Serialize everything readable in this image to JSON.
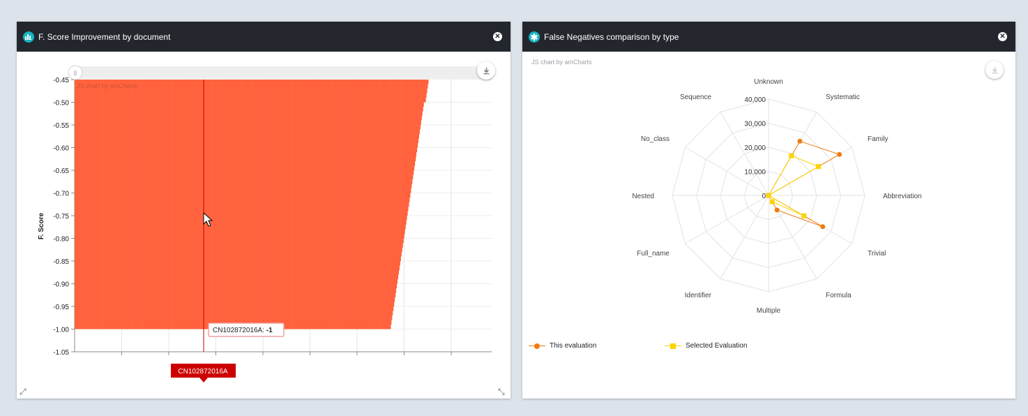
{
  "colors": {
    "header_bg": "#23272d",
    "icon_accent": "#17b4c2",
    "bar_fill": "#ff623d",
    "this_eval": "#f07b12",
    "selected_eval": "#fcd202",
    "cursor_line": "#cc0000",
    "tooltip_bg": "#cc0000"
  },
  "left_panel": {
    "title": "F. Score Improvement by document",
    "icon": "bar-chart-icon",
    "close_icon": "close-icon",
    "credit": "JS chart by amCharts",
    "tooltip_value_label": "CN102872016A:",
    "tooltip_value": "-1",
    "cursor_category": "CN102872016A",
    "scrollbar_grip": "||"
  },
  "right_panel": {
    "title": "False Negatives comparison by type",
    "icon": "asterisk-icon",
    "close_icon": "close-icon",
    "credit": "JS chart by amCharts"
  },
  "chart_data": [
    {
      "type": "bar",
      "title": "",
      "ylabel": "F. Score",
      "xlabel": "",
      "ylim": [
        -1.05,
        -0.45
      ],
      "yticks": [
        "-0.45",
        "-0.50",
        "-0.55",
        "-0.60",
        "-0.65",
        "-0.70",
        "-0.75",
        "-0.80",
        "-0.85",
        "-0.90",
        "-0.95",
        "-1.00",
        "-1.05"
      ],
      "grid": true,
      "series": [
        {
          "values": [
            -0.45,
            -0.45,
            -0.45,
            -0.45,
            -0.45,
            -0.45,
            -0.45,
            -0.45,
            -0.45,
            -0.45,
            -0.45,
            -0.45,
            -0.45,
            -0.45,
            -0.45,
            -0.45,
            -0.45,
            -0.45,
            -0.45,
            -0.45,
            -0.45,
            -0.45,
            -0.45,
            -0.45,
            -0.45,
            -0.45,
            -0.45,
            -0.45,
            -0.45,
            -0.45,
            -0.45,
            -0.45,
            -0.45,
            -0.45,
            -0.45,
            -0.45,
            -0.45,
            -0.45,
            -0.45,
            -0.45,
            -0.45,
            -0.45,
            -0.45,
            -0.45,
            -0.45,
            -0.45,
            -0.45,
            -0.45,
            -0.45,
            -0.45,
            -0.45,
            -0.45,
            -0.45,
            -0.45,
            -0.45,
            -0.45,
            -0.45,
            -0.45,
            -0.45,
            -0.45,
            -0.45,
            -0.45,
            -0.45,
            -0.45,
            -0.45,
            -0.45,
            -0.45,
            -0.45,
            -0.45,
            -0.45,
            -0.45,
            -0.45,
            -0.45,
            -0.45,
            -0.45,
            -0.45,
            -0.45,
            -0.45,
            -0.45,
            -0.45,
            -0.45,
            -0.45,
            -0.45,
            -0.45,
            -0.45,
            -0.45,
            -0.45,
            -0.45,
            -0.45,
            -0.45,
            -0.45,
            -0.45,
            -0.45,
            -0.45,
            -0.46,
            -0.47,
            -0.48,
            -0.49,
            -0.5,
            -0.5,
            -0.5,
            -0.51,
            -0.52,
            -0.53,
            -0.54,
            -0.55,
            -0.56,
            -0.57,
            -0.58,
            -0.59,
            -0.6,
            -0.61,
            -0.62,
            -0.63,
            -0.64,
            -0.65,
            -0.66,
            -0.67,
            -0.68,
            -0.69,
            -0.7,
            -0.71,
            -0.72,
            -0.73,
            -0.74,
            -0.75,
            -0.76,
            -0.77,
            -0.78,
            -0.79,
            -0.8,
            -0.81,
            -0.82,
            -0.83,
            -0.84,
            -0.85,
            -0.86,
            -0.87,
            -0.88,
            -0.89,
            -0.9,
            -0.91,
            -0.92,
            -0.93,
            -0.94,
            -0.95,
            -0.96,
            -0.97,
            -0.98,
            -0.99,
            -1.0,
            -1.0,
            -1.0,
            -1.0,
            -1.0,
            -1.0,
            -1.0,
            -1.0,
            -1.0,
            -1.0,
            -1.0,
            -1.0,
            -1.0,
            -1.0,
            -1.0,
            -1.0,
            -1.0,
            -1.0,
            -1.0,
            -1.0,
            -1.0,
            -1.0,
            -1.0,
            -1.0,
            -1.0,
            -1.0,
            -1.0,
            -1.0,
            -1.0,
            -1.0,
            -1.0,
            -1.0,
            -1.0,
            -1.0,
            -1.0,
            -1.0,
            -1.0,
            -1.0,
            -1.0,
            -1.0,
            -1.0,
            -1.0,
            -1.0,
            -1.0,
            -1.0,
            -1.0,
            -1.0,
            -1.0,
            -1.0,
            -1.0,
            -1.0,
            -1.0,
            -1.0,
            -1.0,
            -1.0,
            -1.0,
            -1.0,
            -1.0,
            -1.0,
            -1.0,
            -1.0,
            -1.0,
            -1.0,
            -1.0,
            -1.0,
            -1.0,
            -1.0,
            -1.0,
            -1.0,
            -1.0,
            -1.0,
            -1.0,
            -1.0,
            -1.0,
            -1.0,
            -1.0,
            -1.0,
            -1.0,
            -1.0,
            -1.0,
            -1.0,
            -1.0,
            -1.0,
            -1.0,
            -1.0,
            -1.0,
            -1.0,
            -1.0,
            -1.0,
            -1.0,
            -1.0,
            -1.0,
            -1.0,
            -1.0,
            -1.0,
            -1.0,
            -1.0,
            -1.0,
            -1.0,
            -1.0,
            -1.0,
            -1.0,
            -1.0,
            -1.0,
            -1.0,
            -1.0,
            -1.0,
            -1.0,
            -1.0,
            -1.0,
            -1.0,
            -1.0,
            -1.0,
            -1.0,
            -1.0,
            -1.0,
            -1.0,
            -1.0,
            -1.0,
            -1.0,
            -1.0,
            -1.0,
            -1.0,
            -1.0,
            -1.0,
            -1.0,
            -1.0,
            -1.0,
            -1.0,
            -1.0,
            -1.0,
            -1.0,
            -1.0,
            -1.0,
            -1.0,
            -1.0,
            -1.0,
            -1.0,
            -1.0,
            -1.0,
            -1.0,
            -1.0,
            -1.0,
            -1.0,
            -1.0,
            -1.0,
            -1.0,
            -1.0,
            -1.0,
            -1.0,
            -1.0,
            -1.0,
            -1.0,
            -1.0,
            -1.0,
            -1.0,
            -1.0,
            -1.0,
            -1.0,
            -1.0,
            -1.0,
            -1.0,
            -1.0,
            -1.0,
            -1.0,
            -1.0,
            -1.0,
            -1.0,
            -1.0,
            -1.0,
            -1.0,
            -1.0,
            -1.0,
            -1.0,
            -1.0,
            -1.0,
            -1.0,
            -1.0,
            -1.0,
            -1.0,
            -1.0,
            -1.0,
            -1.0,
            -1.0,
            -1.0,
            -1.0,
            -1.0,
            -1.0,
            -1.0,
            -1.0,
            -1.0,
            -1.0,
            -1.0,
            -1.0,
            -1.0,
            -1.0,
            -1.0,
            -1.0,
            -1.0,
            -1.0,
            -1.0,
            -1.0,
            -1.0,
            -1.0,
            -1.0,
            -1.0,
            -1.0,
            -1.0,
            -1.0,
            -1.0,
            -1.0,
            -1.0,
            -1.0,
            -1.0,
            -1.0,
            -1.0,
            -1.0,
            -1.0,
            -1.0,
            -1.0,
            -1.0,
            -1.0,
            -1.0,
            -1.0,
            -1.0,
            -1.0,
            -1.0,
            -1.0,
            -1.0,
            -1.0,
            -1.0,
            -1.0,
            -1.0,
            -1.0,
            -1.0,
            -1.0,
            -1.0,
            -1.0,
            -1.0,
            -1.0,
            -1.0,
            -1.0,
            -1.0,
            -1.0,
            -1.0,
            -1.0,
            -1.0,
            -1.0,
            -1.0,
            -1.0,
            -1.0,
            -1.0,
            -1.0,
            -1.0,
            -1.0,
            -1.0,
            -1.0,
            -1.0,
            -1.0,
            -1.0,
            -1.0,
            -1.0,
            -1.0,
            -1.0,
            -1.0,
            -1.0,
            -1.0,
            -1.0,
            -1.0,
            -1.0,
            -1.0,
            -1.0,
            -1.0,
            -1.0,
            -1.0,
            -1.0,
            -1.0,
            -1.0,
            -1.0,
            -1.0,
            -1.0,
            -1.0,
            -1.0,
            -1.0,
            -1.0,
            -1.0,
            -1.0,
            -1.0,
            -1.0,
            -1.0,
            -1.0,
            -1.0,
            -1.0,
            -1.0,
            -1.0,
            -1.0,
            -1.0,
            -1.0,
            -1.0,
            -1.0,
            -1.0,
            -1.0,
            -1.0,
            -1.0,
            -1.0,
            -1.0,
            -1.0,
            -1.0,
            -1.0,
            -1.0,
            -1.0,
            -1.0,
            -1.0,
            -1.0,
            -1.0,
            -1.0,
            -1.0,
            -1.0,
            -1.0,
            -1.0,
            -1.0,
            -1.0,
            -1.0,
            -1.0,
            -1.0,
            -1.0,
            -1.0,
            -1.0,
            -1.0,
            -1.0,
            -1.0,
            -1.0,
            -1.0,
            -1.0,
            -1.0,
            -1.0,
            -1.0,
            -1.0,
            -1.0,
            -1.0,
            -1.0,
            -1.0,
            -1.0,
            -1.0,
            -1.0,
            -1.0,
            -1.0,
            -1.0,
            -1.0,
            -1.0,
            -1.0,
            -1.0,
            -1.0,
            -1.0,
            -1.0,
            -1.0,
            -1.0,
            -1.0,
            -1.0,
            -1.0,
            -1.0,
            -1.0,
            -1.0,
            -1.0,
            -1.0,
            -1.0,
            -1.0,
            -1.0,
            -1.0,
            -1.0,
            -1.0,
            -1.0,
            -1.0,
            -1.0,
            -1.0,
            -1.0,
            -1.0,
            -1.0,
            -1.0,
            -1.0,
            -1.0,
            -1.0,
            -1.0,
            -1.0,
            -1.0,
            -1.0,
            -1.0,
            -1.0,
            -1.0,
            -1.0,
            -1.0,
            -1.0,
            -1.0,
            -1.0,
            -1.0,
            -1.0,
            -1.0,
            -1.0,
            -1.0,
            -1.0,
            -1.0,
            -1.0,
            -1.0,
            -1.0,
            -1.0,
            -1.0,
            -1.0,
            -1.0,
            -1.0,
            -1.0,
            -1.0,
            -1.0,
            -1.0,
            -1.0,
            -1.0,
            -1.0,
            -1.0,
            -1.0,
            -1.0,
            -1.0,
            -1.0,
            -1.0,
            -1.0,
            -1.0,
            -1.0,
            -1.0,
            -1.0,
            -1.0,
            -1.0,
            -1.0,
            -1.0,
            -1.0,
            -1.0,
            -1.0,
            -1.0,
            -1.0,
            -1.0,
            -1.0,
            -1.0,
            -1.0,
            -1.0,
            -1.0,
            -1.0,
            -1.0,
            -1.0,
            -1.0,
            -1.0,
            -1.0,
            -1.0,
            -1.0,
            -1.0,
            -1.0,
            -1.0,
            -1.0,
            -1.0,
            -1.0,
            -1.0,
            -1.0,
            -1.0,
            -1.0,
            -1.0,
            -1.0,
            -1.0,
            -1.0,
            -1.0,
            -1.0,
            -1.0,
            -1.0,
            -1.0
          ]
        }
      ]
    },
    {
      "type": "radar",
      "title": "",
      "categories": [
        "Unknown",
        "Systematic",
        "Family",
        "Abbreviation",
        "Trivial",
        "Formula",
        "Multiple",
        "Identifier",
        "Full_name",
        "Nested",
        "No_class",
        "Sequence"
      ],
      "rlim": [
        0,
        40000
      ],
      "rticks": [
        "0",
        "10,000",
        "20,000",
        "30,000",
        "40,000"
      ],
      "legend_position": "bottom-left",
      "series": [
        {
          "name": "This evaluation",
          "values": [
            0,
            26000,
            34000,
            0,
            26000,
            7000,
            0,
            0,
            0,
            0,
            0,
            0
          ]
        },
        {
          "name": "Selected Evaluation",
          "values": [
            0,
            19000,
            24000,
            0,
            17000,
            3000,
            0,
            0,
            0,
            0,
            0,
            0
          ]
        }
      ]
    }
  ]
}
